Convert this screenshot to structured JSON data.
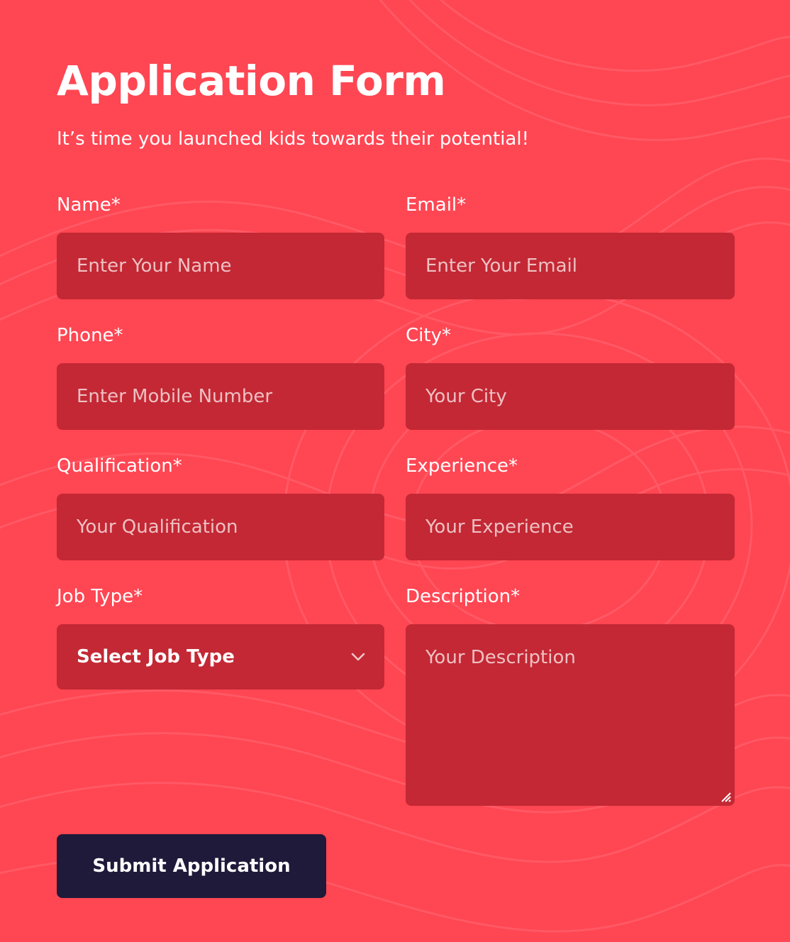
{
  "form": {
    "title": "Application Form",
    "subtitle": "It’s time you launched kids towards their potential!",
    "fields": {
      "name": {
        "label": "Name*",
        "placeholder": "Enter Your Name"
      },
      "email": {
        "label": "Email*",
        "placeholder": "Enter Your Email"
      },
      "phone": {
        "label": "Phone*",
        "placeholder": "Enter Mobile Number"
      },
      "city": {
        "label": "City*",
        "placeholder": "Your City"
      },
      "qualification": {
        "label": "Qualification*",
        "placeholder": "Your Qualification"
      },
      "experience": {
        "label": "Experience*",
        "placeholder": "Your Experience"
      },
      "job_type": {
        "label": "Job Type*",
        "selected": "Select Job Type"
      },
      "description": {
        "label": "Description*",
        "placeholder": "Your Description"
      }
    },
    "submit_label": "Submit Application"
  },
  "icons": {
    "select_chevron": "chevron-down-icon",
    "resize": "resize-handle-icon"
  },
  "colors": {
    "background": "#ff4653",
    "field_background": "#c32834",
    "button_background": "#1f1a3a",
    "text": "#ffffff",
    "placeholder": "#efc0c3"
  }
}
